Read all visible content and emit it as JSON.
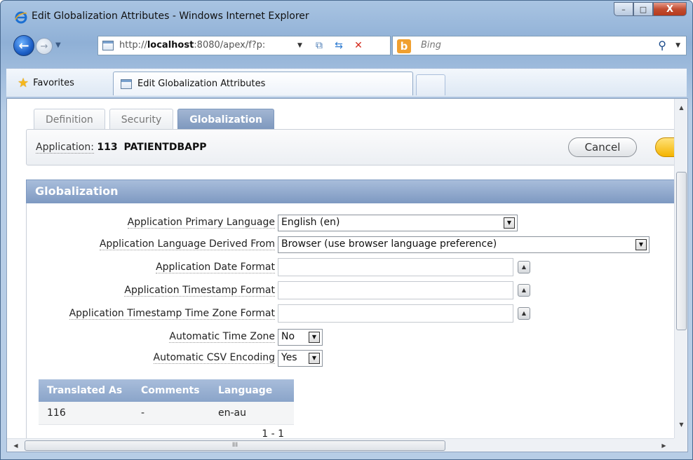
{
  "window": {
    "title": "Edit Globalization Attributes - Windows Internet Explorer",
    "controls": {
      "minimize": "–",
      "maximize": "□",
      "close": "X"
    }
  },
  "navigation": {
    "url_prefix": "http://",
    "url_host": "localhost",
    "url_rest": ":8080/apex/f?p:",
    "search_placeholder": "Bing"
  },
  "favorites_bar": {
    "favorites_label": "Favorites",
    "tab_label": "Edit Globalization Attributes"
  },
  "page": {
    "tabs": [
      "Definition",
      "Security",
      "Globalization"
    ],
    "active_tab": "Globalization",
    "application_label": "Application:",
    "application_id": "113",
    "application_name": "PATIENTDBAPP",
    "cancel_label": "Cancel",
    "region_title": "Globalization",
    "fields": {
      "primary_language": {
        "label": "Application Primary Language",
        "value": "English (en)"
      },
      "language_derived_from": {
        "label": "Application Language Derived From",
        "value": "Browser (use browser language preference)"
      },
      "date_format": {
        "label": "Application Date Format",
        "value": ""
      },
      "timestamp_format": {
        "label": "Application Timestamp Format",
        "value": ""
      },
      "timestamp_tz_format": {
        "label": "Application Timestamp Time Zone Format",
        "value": ""
      },
      "automatic_time_zone": {
        "label": "Automatic Time Zone",
        "value": "No"
      },
      "automatic_csv_encoding": {
        "label": "Automatic CSV Encoding",
        "value": "Yes"
      }
    },
    "report": {
      "columns": [
        "Translated As",
        "Comments",
        "Language"
      ],
      "rows": [
        {
          "translated_as": "116",
          "comments": "-",
          "language": "en-au"
        }
      ],
      "pagination": "1 - 1"
    }
  },
  "scrollbar": {
    "grip": "III"
  }
}
